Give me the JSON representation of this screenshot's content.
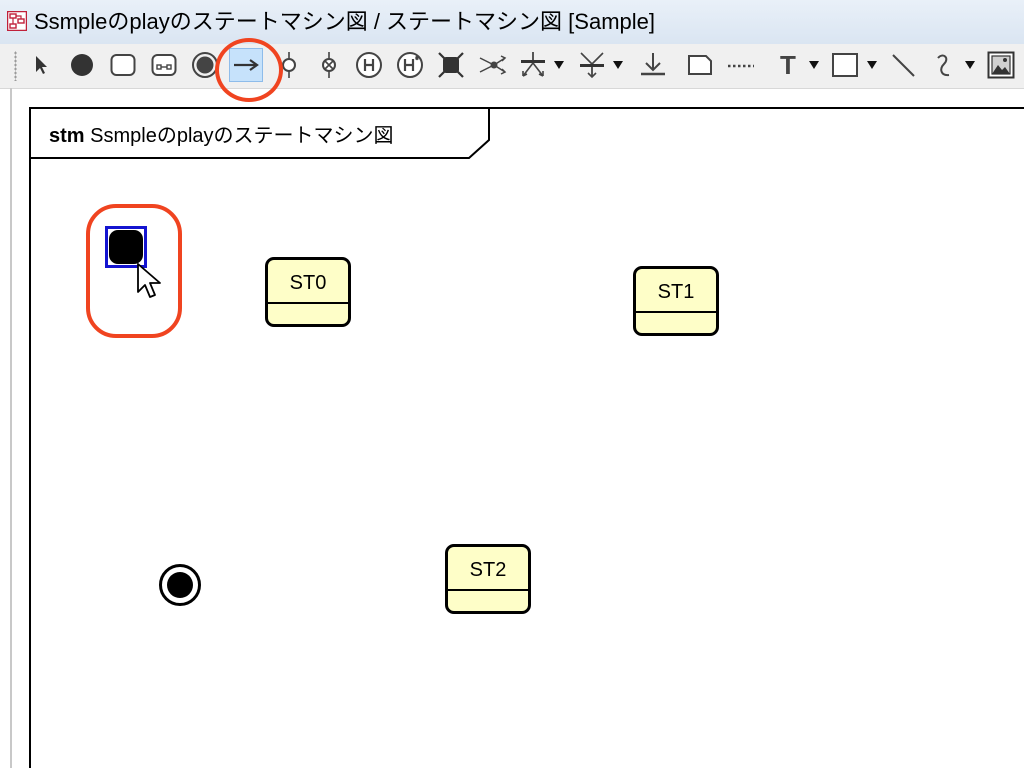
{
  "window": {
    "title": "Ssmpleのplayのステートマシン図 / ステートマシン図 [Sample]",
    "icon": "state-machine-diagram-icon",
    "icon_color": "#c0203a"
  },
  "toolbar": {
    "tools": [
      {
        "name": "select",
        "icon": "arrow-pointer-icon"
      },
      {
        "name": "initial-pseudostate",
        "icon": "filled-circle-icon"
      },
      {
        "name": "state",
        "icon": "rounded-rect-icon"
      },
      {
        "name": "submachine-state",
        "icon": "submachine-state-icon"
      },
      {
        "name": "final-state",
        "icon": "bullseye-icon"
      },
      {
        "name": "transition",
        "icon": "right-arrow-icon",
        "selected": true
      },
      {
        "name": "entry-point",
        "icon": "entry-point-icon"
      },
      {
        "name": "exit-point",
        "icon": "exit-point-icon"
      },
      {
        "name": "shallow-history",
        "icon": "history-h-icon",
        "label": "H"
      },
      {
        "name": "deep-history",
        "icon": "deep-history-icon",
        "label": "H*"
      },
      {
        "name": "terminate",
        "icon": "terminate-x-icon"
      },
      {
        "name": "junction",
        "icon": "junction-icon"
      },
      {
        "name": "fork",
        "icon": "fork-icon"
      },
      {
        "name": "join",
        "icon": "join-icon"
      },
      {
        "name": "choice",
        "icon": "choice-icon"
      },
      {
        "name": "note",
        "icon": "note-icon"
      },
      {
        "name": "note-anchor",
        "icon": "dotted-line-icon"
      },
      {
        "name": "text",
        "icon": "text-t-icon",
        "label": "T"
      },
      {
        "name": "rectangle",
        "icon": "rectangle-icon"
      },
      {
        "name": "line",
        "icon": "line-icon"
      },
      {
        "name": "freehand",
        "icon": "freehand-icon"
      },
      {
        "name": "image",
        "icon": "image-icon"
      }
    ],
    "selected_color": "#c6e2fb"
  },
  "diagram": {
    "frame_keyword": "stm",
    "frame_name": "Ssmpleのplayのステートマシン図",
    "states": [
      {
        "name": "ST0"
      },
      {
        "name": "ST1"
      },
      {
        "name": "ST2"
      }
    ],
    "state_fill": "#fefec8",
    "selection_color": "#1414d0",
    "highlight_color": "#f04420"
  }
}
